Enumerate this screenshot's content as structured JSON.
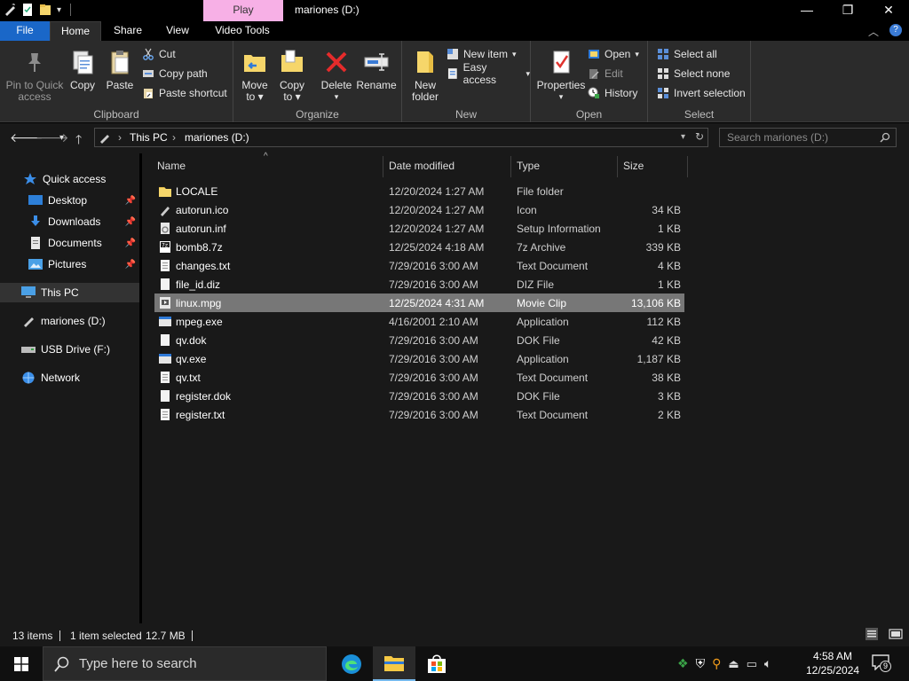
{
  "title_bar": {
    "contextual_tab": "Play",
    "window_title": "mariones (D:)",
    "minimize": "—",
    "maximize": "❐",
    "close": "✕"
  },
  "ribbon_tabs": [
    "File",
    "Home",
    "Share",
    "View",
    "Video Tools"
  ],
  "ribbon": {
    "clipboard": {
      "label": "Clipboard",
      "pin_line1": "Pin to Quick",
      "pin_line2": "access",
      "copy": "Copy",
      "paste": "Paste",
      "cut": "Cut",
      "copy_path": "Copy path",
      "paste_shortcut": "Paste shortcut"
    },
    "organize": {
      "label": "Organize",
      "move_line1": "Move",
      "move_line2": "to",
      "copy_line1": "Copy",
      "copy_line2": "to",
      "delete": "Delete",
      "rename": "Rename"
    },
    "new": {
      "label": "New",
      "folder_line1": "New",
      "folder_line2": "folder",
      "new_item": "New item",
      "easy_access": "Easy access"
    },
    "open": {
      "label": "Open",
      "properties": "Properties",
      "open": "Open",
      "edit": "Edit",
      "history": "History"
    },
    "select": {
      "label": "Select",
      "select_all": "Select all",
      "select_none": "Select none",
      "invert": "Invert selection"
    }
  },
  "address": {
    "crumbs": [
      "This PC",
      "mariones (D:)"
    ],
    "search_placeholder": "Search mariones (D:)"
  },
  "nav_pane": {
    "quick_access": "Quick access",
    "items": [
      "Desktop",
      "Downloads",
      "Documents",
      "Pictures"
    ],
    "this_pc": "This PC",
    "drive_d": "mariones (D:)",
    "usb": "USB Drive (F:)",
    "network": "Network"
  },
  "columns": {
    "name": "Name",
    "date": "Date modified",
    "type": "Type",
    "size": "Size"
  },
  "files": [
    {
      "name": "LOCALE",
      "date": "12/20/2024 1:27 AM",
      "type": "File folder",
      "size": "",
      "icon": "folder-icon"
    },
    {
      "name": "autorun.ico",
      "date": "12/20/2024 1:27 AM",
      "type": "Icon",
      "size": "34 KB",
      "icon": "image-file-icon"
    },
    {
      "name": "autorun.inf",
      "date": "12/20/2024 1:27 AM",
      "type": "Setup Information",
      "size": "1 KB",
      "icon": "settings-file-icon"
    },
    {
      "name": "bomb8.7z",
      "date": "12/25/2024 4:18 AM",
      "type": "7z Archive",
      "size": "339 KB",
      "icon": "archive-icon"
    },
    {
      "name": "changes.txt",
      "date": "7/29/2016 3:00 AM",
      "type": "Text Document",
      "size": "4 KB",
      "icon": "text-file-icon"
    },
    {
      "name": "file_id.diz",
      "date": "7/29/2016 3:00 AM",
      "type": "DIZ File",
      "size": "1 KB",
      "icon": "file-icon"
    },
    {
      "name": "linux.mpg",
      "date": "12/25/2024 4:31 AM",
      "type": "Movie Clip",
      "size": "13,106 KB",
      "icon": "video-file-icon"
    },
    {
      "name": "mpeg.exe",
      "date": "4/16/2001 2:10 AM",
      "type": "Application",
      "size": "112 KB",
      "icon": "application-icon"
    },
    {
      "name": "qv.dok",
      "date": "7/29/2016 3:00 AM",
      "type": "DOK File",
      "size": "42 KB",
      "icon": "file-icon"
    },
    {
      "name": "qv.exe",
      "date": "7/29/2016 3:00 AM",
      "type": "Application",
      "size": "1,187 KB",
      "icon": "application-icon"
    },
    {
      "name": "qv.txt",
      "date": "7/29/2016 3:00 AM",
      "type": "Text Document",
      "size": "38 KB",
      "icon": "text-file-icon"
    },
    {
      "name": "register.dok",
      "date": "7/29/2016 3:00 AM",
      "type": "DOK File",
      "size": "3 KB",
      "icon": "file-icon"
    },
    {
      "name": "register.txt",
      "date": "7/29/2016 3:00 AM",
      "type": "Text Document",
      "size": "2 KB",
      "icon": "text-file-icon"
    }
  ],
  "selected_file": "linux.mpg",
  "status": {
    "count": "13 items",
    "selected": "1 item selected",
    "size": "12.7 MB"
  },
  "taskbar": {
    "search_placeholder": "Type here to search",
    "time": "4:58 AM",
    "date": "12/25/2024",
    "notifications": "9"
  },
  "colors": {
    "file_tab": "#1a67c8",
    "play_tab": "#f7b0e6",
    "background": "#191919",
    "selection": "#777777",
    "accent": "#76b9ed"
  }
}
